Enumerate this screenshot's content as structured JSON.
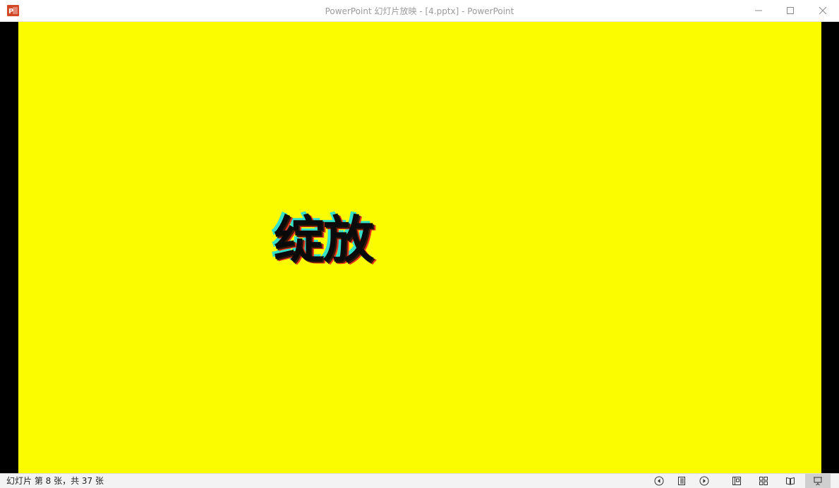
{
  "window": {
    "title": "PowerPoint 幻灯片放映 - [4.pptx] - PowerPoint",
    "app_icon_letter": "P"
  },
  "slide": {
    "text": "绽放",
    "background_color": "#fbfc00"
  },
  "statusbar": {
    "slide_info": "幻灯片 第 8 张，共 37 张"
  },
  "icons": {
    "app": "powerpoint-icon",
    "minimize": "minimize-icon",
    "maximize": "maximize-icon",
    "close": "close-icon",
    "previous": "previous-slide-icon",
    "menu": "slide-menu-icon",
    "next": "next-slide-icon",
    "normal_view": "normal-view-icon",
    "sorter_view": "slide-sorter-icon",
    "reading_view": "reading-view-icon",
    "slideshow_view": "slideshow-view-icon"
  }
}
